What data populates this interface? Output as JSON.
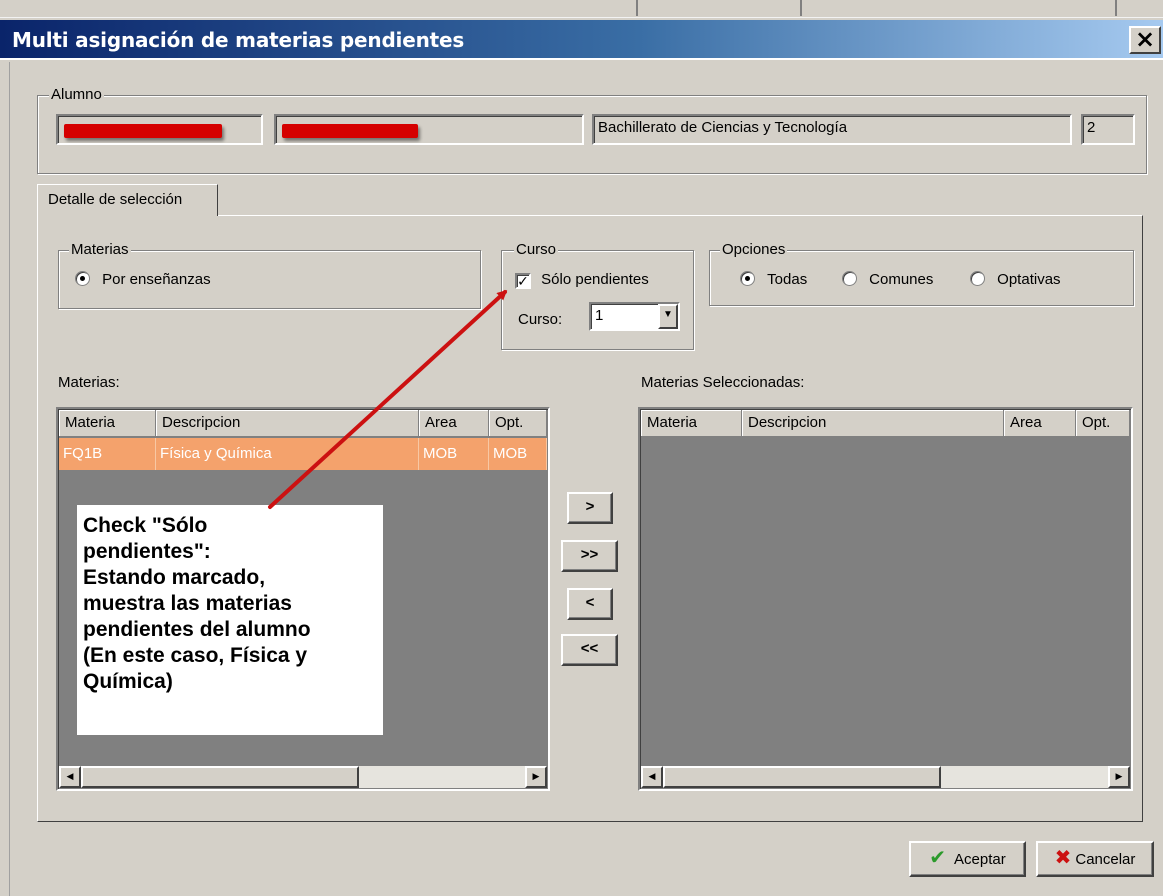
{
  "window": {
    "title": "Multi asignación de materias pendientes",
    "close_glyph": "×"
  },
  "alumno": {
    "legend": "Alumno",
    "field1": "",
    "field2": "",
    "course_name": "Bachillerato de Ciencias y Tecnología",
    "course_level": "2"
  },
  "tab": {
    "label": "Detalle de selección"
  },
  "materias_group": {
    "legend": "Materias",
    "option": "Por enseñanzas"
  },
  "curso_group": {
    "legend": "Curso",
    "checkbox_label": "Sólo pendientes",
    "curso_label": "Curso:",
    "curso_value": "1"
  },
  "opciones_group": {
    "legend": "Opciones",
    "options": [
      "Todas",
      "Comunes",
      "Optativas"
    ],
    "selected": "Todas"
  },
  "materias_list": {
    "label": "Materias:",
    "columns": [
      "Materia",
      "Descripcion",
      "Area",
      "Opt."
    ],
    "rows": [
      {
        "materia": "FQ1B",
        "descripcion": "Física y Química",
        "area": "MOB",
        "opt": "MOB"
      }
    ]
  },
  "selected_list": {
    "label": "Materias Seleccionadas:",
    "columns": [
      "Materia",
      "Descripcion",
      "Area",
      "Opt."
    ]
  },
  "transfer_buttons": {
    "add_one": ">",
    "add_all": ">>",
    "remove_one": "<",
    "remove_all": "<<"
  },
  "annotation": {
    "lines": [
      " Check \"Sólo",
      "pendientes\":",
      "Estando marcado,",
      "muestra las materias",
      "pendientes del alumno",
      "(En este caso, Física y",
      "Química)"
    ],
    "arrow_color": "#cc1111"
  },
  "footer": {
    "accept": "Aceptar",
    "cancel": "Cancelar"
  },
  "colors": {
    "selected_row": "#f4a26c",
    "title_start": "#0a246a",
    "title_end": "#a6caf0",
    "redaction": "#d50000"
  }
}
